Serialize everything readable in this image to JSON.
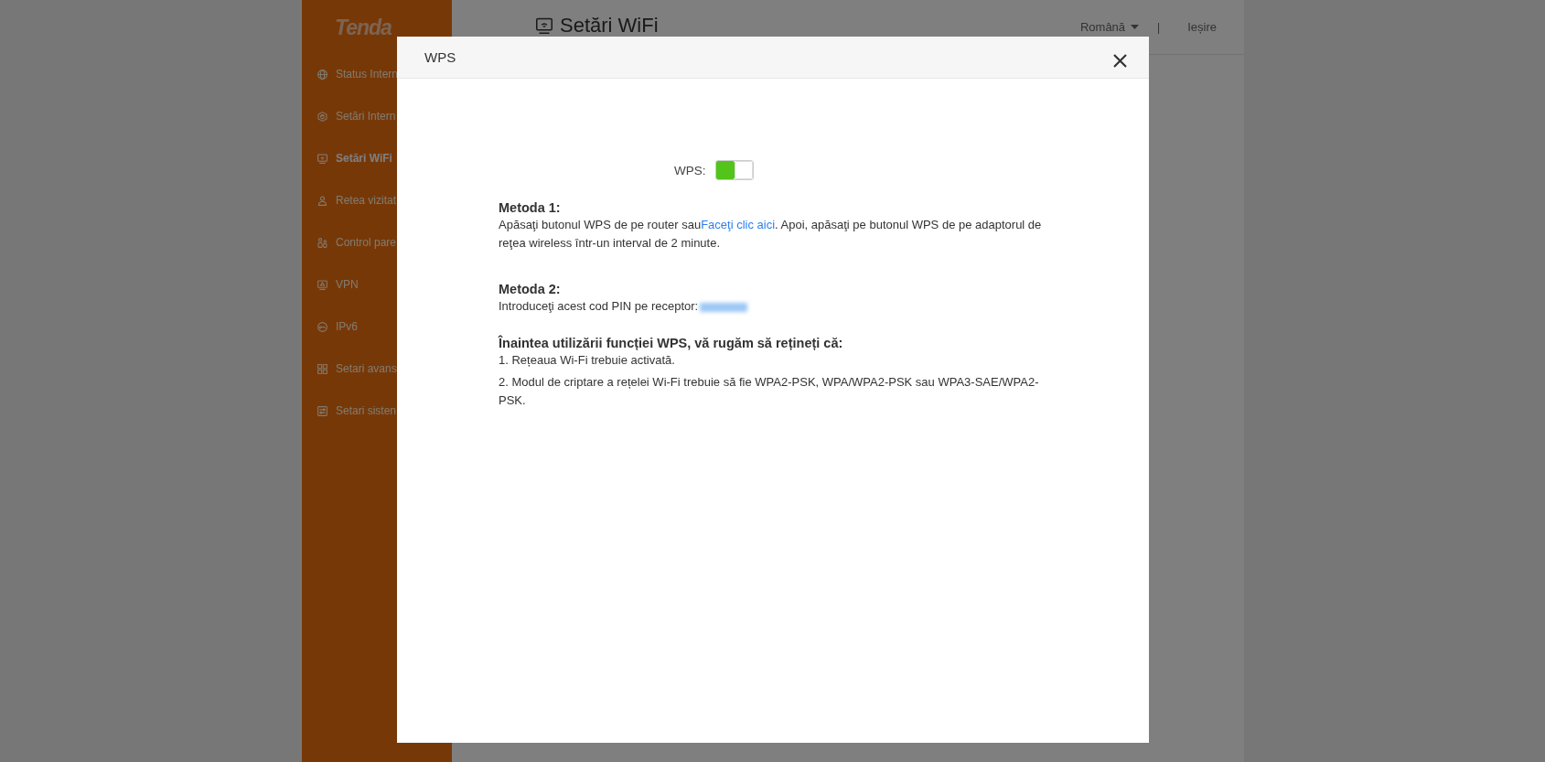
{
  "sidebar": {
    "logo": "Tenda",
    "items": [
      {
        "label": "Status Intern",
        "selected": false
      },
      {
        "label": "Setări Intern",
        "selected": false
      },
      {
        "label": "Setări WiFi",
        "selected": true
      },
      {
        "label": "Retea vizitat",
        "selected": false
      },
      {
        "label": "Control pare",
        "selected": false
      },
      {
        "label": "VPN",
        "selected": false
      },
      {
        "label": "IPv6",
        "selected": false
      },
      {
        "label": "Setari avans",
        "selected": false
      },
      {
        "label": "Setari sisten",
        "selected": false
      }
    ]
  },
  "header": {
    "title": "Setări WiFi",
    "language": "Română",
    "separator": "|",
    "logout": "Ieșire"
  },
  "modal": {
    "title": "WPS",
    "wps_toggle": {
      "label": "WPS:",
      "on": true
    },
    "method1": {
      "heading": "Metoda 1:",
      "text_before": "Apăsaţi butonul WPS de pe router sau",
      "link": "Faceţi clic aici",
      "text_after": ". Apoi, apăsaţi pe butonul WPS de pe adaptorul de reţea wireless într-un interval de 2 minute."
    },
    "method2": {
      "heading": "Metoda 2:",
      "text": "Introduceţi acest cod PIN pe receptor:"
    },
    "notes": {
      "heading": "Înaintea utilizării funcției WPS, vă rugăm să rețineți că:",
      "items": [
        "1. Rețeaua Wi-Fi trebuie activată.",
        "2. Modul de criptare a rețelei Wi-Fi trebuie să fie WPA2-PSK, WPA/WPA2-PSK sau WPA3-SAE/WPA2-PSK."
      ]
    }
  }
}
